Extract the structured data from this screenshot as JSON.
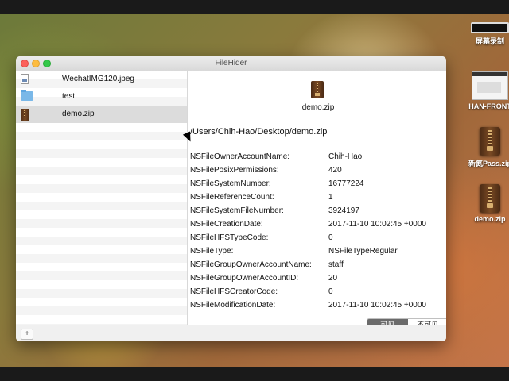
{
  "window": {
    "title": "FileHider",
    "files": [
      {
        "name": "WechatIMG120.jpeg",
        "icon": "image-file-icon",
        "selected": false
      },
      {
        "name": "test",
        "icon": "folder-icon",
        "selected": false
      },
      {
        "name": "demo.zip",
        "icon": "zip-file-icon",
        "selected": true
      }
    ],
    "add_label": "+"
  },
  "detail": {
    "file_name": "demo.zip",
    "path": "/Users/Chih-Hao/Desktop/demo.zip",
    "attributes": [
      {
        "key": "NSFileOwnerAccountName:",
        "value": "Chih-Hao"
      },
      {
        "key": "NSFilePosixPermissions:",
        "value": "420"
      },
      {
        "key": "NSFileSystemNumber:",
        "value": "16777224"
      },
      {
        "key": "NSFileReferenceCount:",
        "value": "1"
      },
      {
        "key": "NSFileSystemFileNumber:",
        "value": "3924197"
      },
      {
        "key": "NSFileCreationDate:",
        "value": "2017-11-10 10:02:45 +0000"
      },
      {
        "key": "NSFileHFSTypeCode:",
        "value": "0"
      },
      {
        "key": "NSFileType:",
        "value": "NSFileTypeRegular"
      },
      {
        "key": "NSFileGroupOwnerAccountName:",
        "value": "staff"
      },
      {
        "key": "NSFileGroupOwnerAccountID:",
        "value": "20"
      },
      {
        "key": "NSFileHFSCreatorCode:",
        "value": "0"
      },
      {
        "key": "NSFileModificationDate:",
        "value": "2017-11-10 10:02:45 +0000"
      }
    ],
    "visibility": {
      "visible_label": "可见",
      "hidden_label": "不可见",
      "selected": "visible"
    }
  },
  "desktop_icons": [
    {
      "label": "屏幕录制",
      "kind": "screen-recording"
    },
    {
      "label": "HAN-FRONT",
      "kind": "screenshot"
    },
    {
      "label": "新氮Pass.zip",
      "kind": "zip"
    },
    {
      "label": "demo.zip",
      "kind": "zip"
    }
  ],
  "colors": {
    "selected_row": "#dcdcdc",
    "segment_active": "#6b6b6b"
  }
}
